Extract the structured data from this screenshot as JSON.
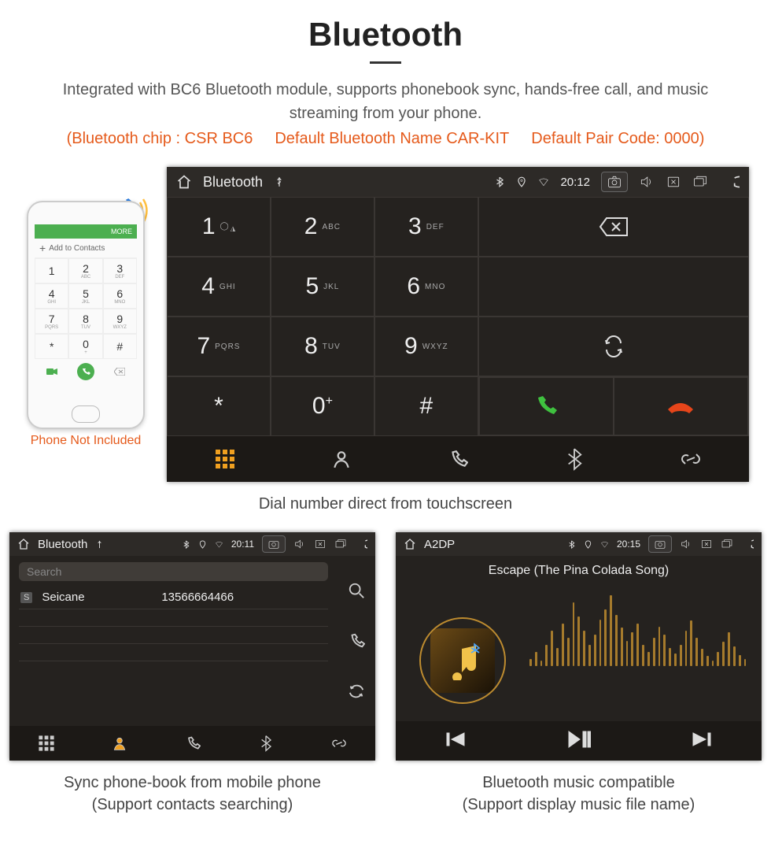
{
  "header": {
    "title": "Bluetooth"
  },
  "description": "Integrated with BC6 Bluetooth module, supports phonebook sync, hands-free call, and music streaming from your phone.",
  "spec": {
    "chip": "(Bluetooth chip : CSR BC6",
    "name": "Default Bluetooth Name CAR-KIT",
    "pair": "Default Pair Code: 0000)"
  },
  "phone_note": "Phone Not Included",
  "mock_phone": {
    "more": "MORE",
    "add": "Add to Contacts",
    "keys": [
      {
        "n": "1",
        "s": ""
      },
      {
        "n": "2",
        "s": "ABC"
      },
      {
        "n": "3",
        "s": "DEF"
      },
      {
        "n": "4",
        "s": "GHI"
      },
      {
        "n": "5",
        "s": "JKL"
      },
      {
        "n": "6",
        "s": "MNO"
      },
      {
        "n": "7",
        "s": "PQRS"
      },
      {
        "n": "8",
        "s": "TUV"
      },
      {
        "n": "9",
        "s": "WXYZ"
      },
      {
        "n": "*",
        "s": ""
      },
      {
        "n": "0",
        "s": "+"
      },
      {
        "n": "#",
        "s": ""
      }
    ]
  },
  "dialer": {
    "title": "Bluetooth",
    "time": "20:12",
    "keys": [
      {
        "n": "1",
        "sub": "o_o"
      },
      {
        "n": "2",
        "sub": "ABC"
      },
      {
        "n": "3",
        "sub": "DEF"
      },
      {
        "n": "4",
        "sub": "GHI"
      },
      {
        "n": "5",
        "sub": "JKL"
      },
      {
        "n": "6",
        "sub": "MNO"
      },
      {
        "n": "7",
        "sub": "PQRS"
      },
      {
        "n": "8",
        "sub": "TUV"
      },
      {
        "n": "9",
        "sub": "WXYZ"
      },
      {
        "n": "*",
        "sub": ""
      },
      {
        "n": "0",
        "sub": "+"
      },
      {
        "n": "#",
        "sub": ""
      }
    ]
  },
  "caption_dial": "Dial number direct from touchscreen",
  "phonebook": {
    "title": "Bluetooth",
    "time": "20:11",
    "search": "Search",
    "contact_badge": "S",
    "contact_name": "Seicane",
    "contact_number": "13566664466"
  },
  "caption_pb_l1": "Sync phone-book from mobile phone",
  "caption_pb_l2": "(Support contacts searching)",
  "a2dp": {
    "title": "A2DP",
    "time": "20:15",
    "song": "Escape (The Pina Colada Song)"
  },
  "caption_a2_l1": "Bluetooth music compatible",
  "caption_a2_l2": "(Support display music file name)"
}
